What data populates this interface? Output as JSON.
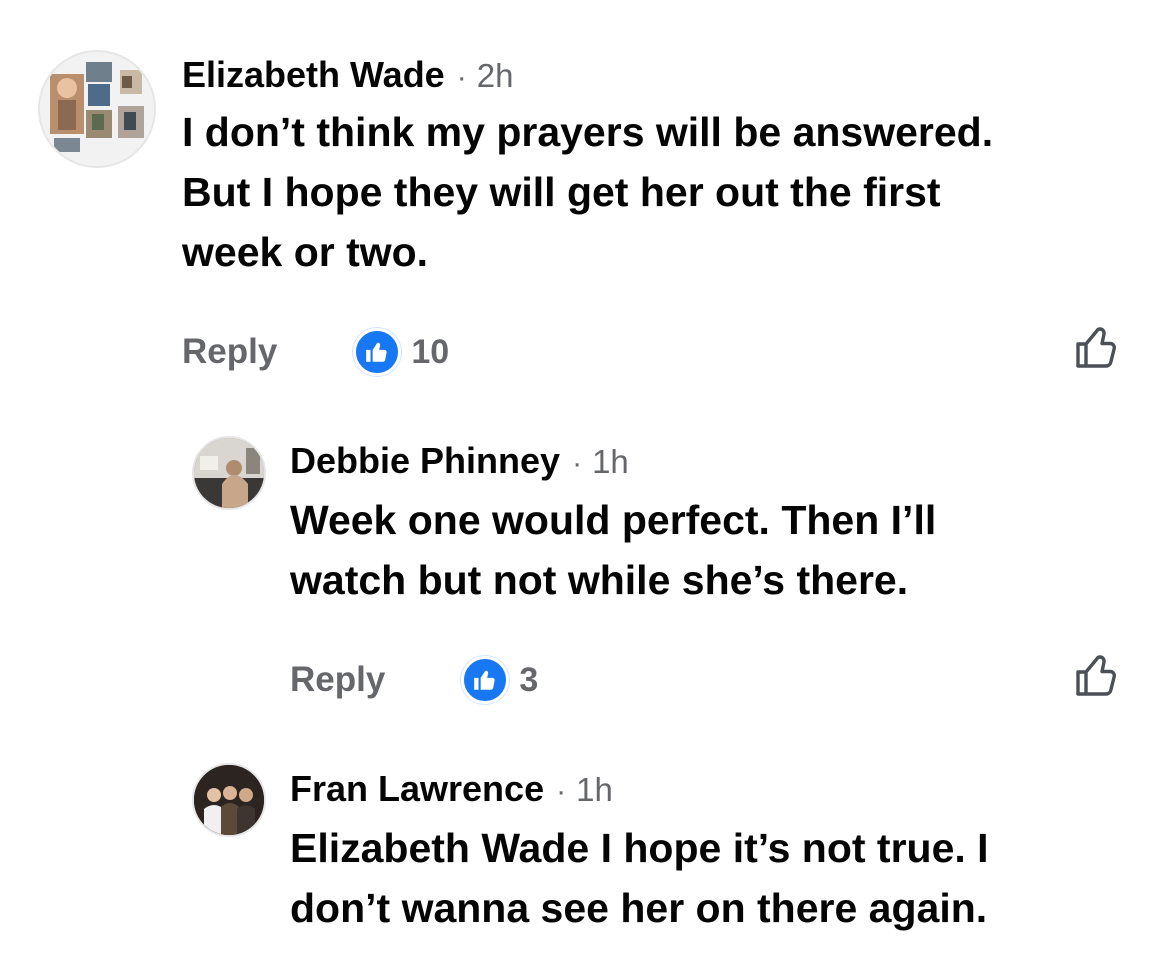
{
  "comments": [
    {
      "author": "Elizabeth Wade",
      "separator": "·",
      "time": "2h",
      "text": "I don’t think my prayers will be answered.\nBut I hope they will get her out the first\nweek or two.",
      "reply_label": "Reply",
      "like_count": "10",
      "reaction_icon": "thumbs-up-icon",
      "like_button_icon": "thumbs-up-outline-icon"
    },
    {
      "author": "Debbie Phinney",
      "separator": "·",
      "time": "1h",
      "text": "Week one would perfect. Then I’ll\nwatch but not while she’s there.",
      "reply_label": "Reply",
      "like_count": "3",
      "reaction_icon": "thumbs-up-icon",
      "like_button_icon": "thumbs-up-outline-icon"
    },
    {
      "author": "Fran Lawrence",
      "separator": "·",
      "time": "1h",
      "text": "Elizabeth Wade I hope it’s not true. I\ndon’t wanna see her on there again."
    }
  ],
  "colors": {
    "primary_text": "#050505",
    "secondary_text": "#65676b",
    "like_blue": "#1877f2"
  }
}
